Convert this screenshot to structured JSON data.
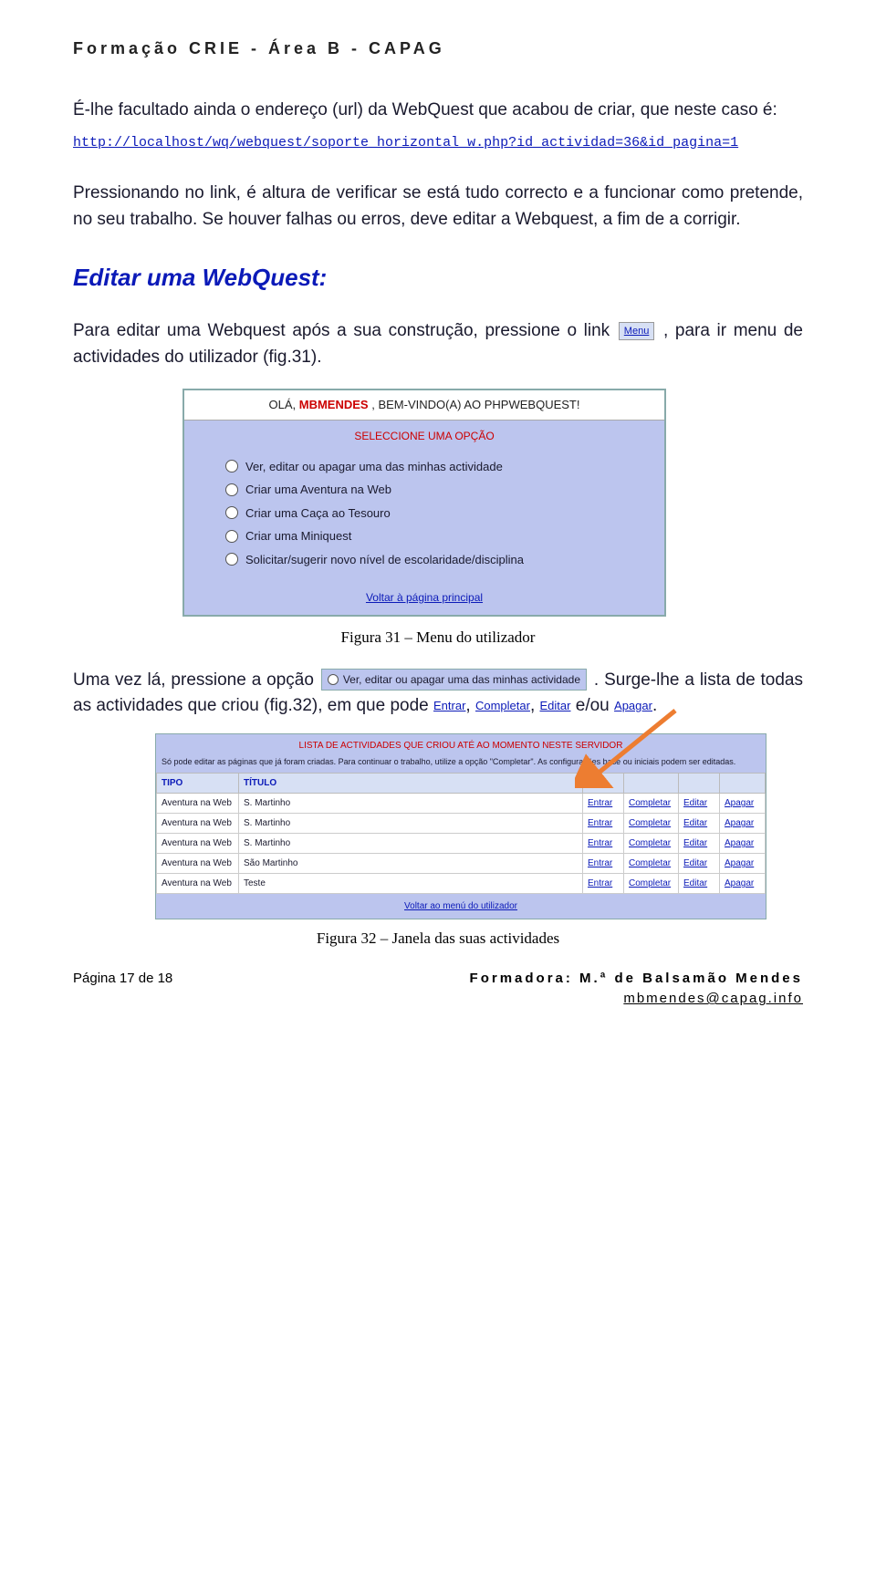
{
  "header": "Formação CRIE - Área B - CAPAG",
  "p1": "É-lhe facultado ainda o endereço (url) da WebQuest que acabou de criar, que neste caso é:",
  "url": "http://localhost/wq/webquest/soporte_horizontal_w.php?id_actividad=36&id_pagina=1",
  "p2": "Pressionando no link, é altura de verificar se está tudo correcto e a funcionar como pretende, no seu trabalho. Se houver falhas ou erros, deve editar a Webquest, a fim de a corrigir.",
  "heading": "Editar uma WebQuest:",
  "p3_before": "Para editar uma Webquest após a sua construção, pressione o link ",
  "p3_chip": "Menu",
  "p3_after": ", para ir menu de actividades do utilizador (fig.31).",
  "fig31": {
    "greet_pre": "OLÁ, ",
    "greet_name": "MBMENDES",
    "greet_post": " , BEM-VINDO(A) AO PHPWEBQUEST!",
    "subtitle": "SELECCIONE UMA OPÇÃO",
    "options": [
      "Ver, editar ou apagar uma das minhas actividade",
      "Criar uma Aventura na Web",
      "Criar uma Caça ao Tesouro",
      "Criar uma Miniquest",
      "Solicitar/sugerir novo nível de escolaridade/disciplina"
    ],
    "footer": "Voltar à página principal",
    "caption": "Figura 31 – Menu do utilizador"
  },
  "p4_before": "Uma vez lá, pressione a opção ",
  "p4_chip": "Ver, editar ou apagar uma das minhas actividade",
  "p4_after": ". Surge-lhe a lista de todas as actividades que criou (fig.32), em que pode ",
  "chips": {
    "entrar": "Entrar",
    "completar": "Completar",
    "editar": "Editar",
    "apagar": "Apagar",
    "eou": " e/ou "
  },
  "fig32": {
    "title": "LISTA DE ACTIVIDADES QUE CRIOU ATÉ AO MOMENTO NESTE SERVIDOR",
    "note": "Só pode editar as páginas que já foram criadas. Para continuar o trabalho, utilize a opção \"Completar\". As configurações base ou iniciais podem ser editadas.",
    "col_tipo": "TIPO",
    "col_titulo": "TÍTULO",
    "rows": [
      {
        "tipo": "Aventura na Web",
        "titulo": "S. Martinho"
      },
      {
        "tipo": "Aventura na Web",
        "titulo": "S. Martinho"
      },
      {
        "tipo": "Aventura na Web",
        "titulo": "S. Martinho"
      },
      {
        "tipo": "Aventura na Web",
        "titulo": "São Martinho"
      },
      {
        "tipo": "Aventura na Web",
        "titulo": "Teste"
      }
    ],
    "actions": [
      "Entrar",
      "Completar",
      "Editar",
      "Apagar"
    ],
    "footer": "Voltar ao menú do utilizador",
    "caption": "Figura 32 – Janela das suas actividades"
  },
  "footer": {
    "left": "Página 17 de 18",
    "right_label": "Formadora: M.ª de Balsamão Mendes",
    "email": "mbmendes@capag.info"
  }
}
